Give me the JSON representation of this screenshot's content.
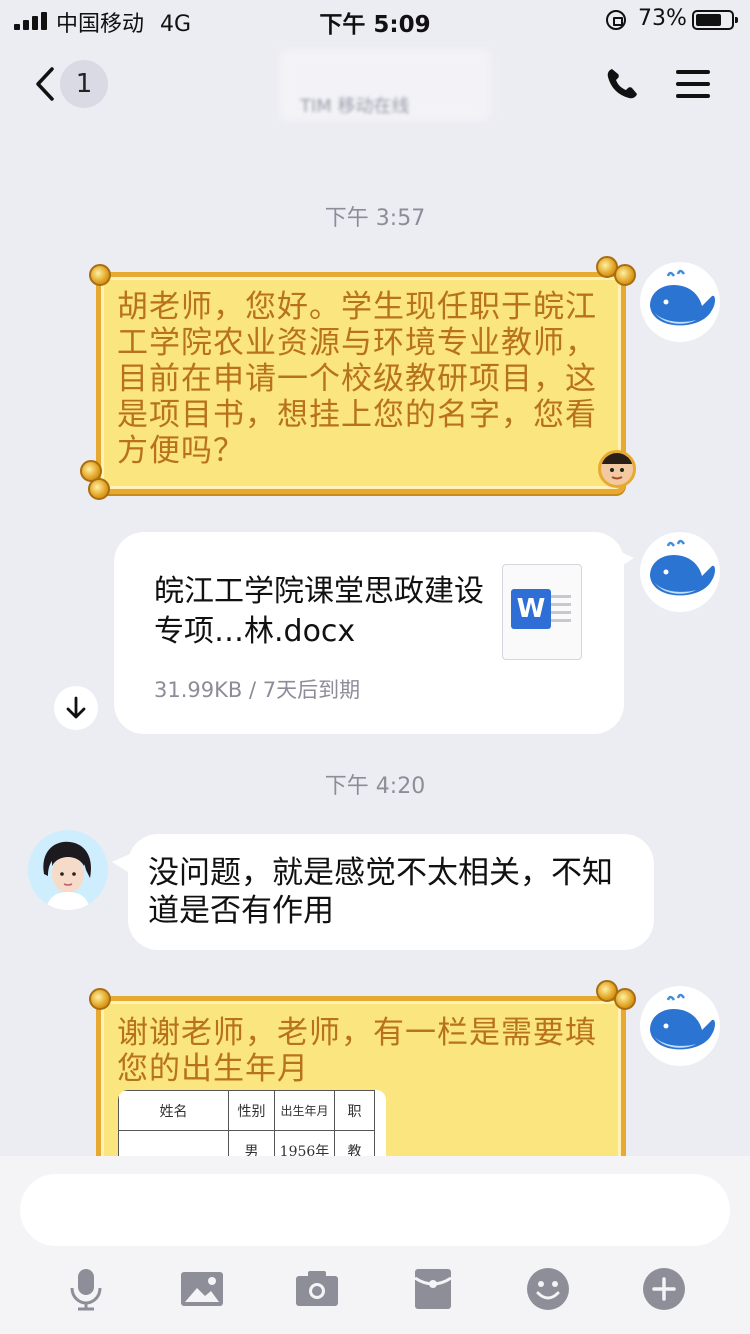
{
  "status_bar": {
    "carrier": "中国移动",
    "network": "4G",
    "time": "下午 5:09",
    "battery_percent": "73%",
    "battery_level": 0.73
  },
  "nav": {
    "unread_count": "1",
    "contact_status": "TIM 移动在线"
  },
  "timestamps": [
    "下午 3:57",
    "下午 4:20"
  ],
  "messages": [
    {
      "side": "right",
      "style": "gold",
      "text": "胡老师，您好。学生现任职于皖江工学院农业资源与环境专业教师，目前在申请一个校级教研项目，这是项目书，想挂上您的名字，您看方便吗？"
    },
    {
      "side": "right",
      "style": "file",
      "file_name": "皖江工学院课堂思政建设专项…林.docx",
      "file_meta": "31.99KB / 7天后到期",
      "file_icon_letter": "W"
    },
    {
      "side": "left",
      "style": "white",
      "text": "没问题，就是感觉不太相关，不知道是否有作用"
    },
    {
      "side": "right",
      "style": "gold",
      "text": "谢谢老师，老师，有一栏是需要填您的出生年月",
      "table_headers": [
        "姓名",
        "性别",
        "出生年月",
        "职"
      ],
      "table_row": [
        "",
        "男",
        "1956年",
        "教"
      ]
    }
  ],
  "colors": {
    "background": "#ececf3",
    "gold_fill": "#fbe57f",
    "gold_border": "#e8a931",
    "gold_text": "#b8731a",
    "word_blue": "#2f6ed4",
    "meta_grey": "#8d8d99"
  }
}
